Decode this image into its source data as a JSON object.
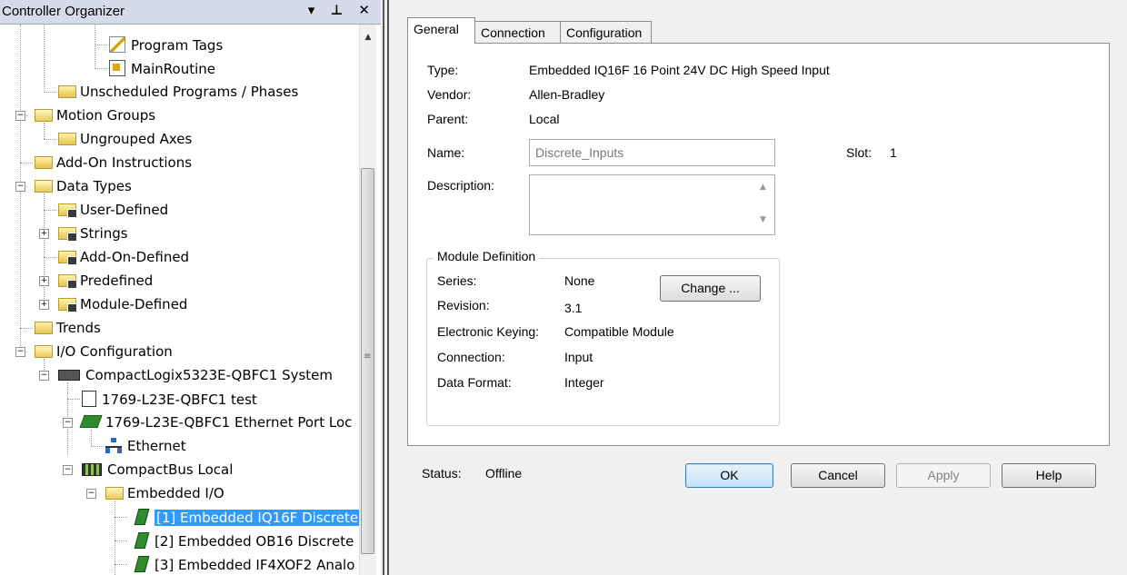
{
  "organizer": {
    "title": "Controller Organizer",
    "header_buttons": "▾ ⊥ ✕",
    "tree": [
      {
        "label": "Program Tags",
        "icon": "pencil-icon"
      },
      {
        "label": "MainRoutine",
        "icon": "routine-icon"
      },
      {
        "label": "Unscheduled Programs / Phases",
        "icon": "folder-icon"
      },
      {
        "label": "Motion Groups",
        "icon": "folder-open-icon"
      },
      {
        "label": "Ungrouped Axes",
        "icon": "folder-icon"
      },
      {
        "label": "Add-On Instructions",
        "icon": "folder-icon"
      },
      {
        "label": "Data Types",
        "icon": "folder-open-icon"
      },
      {
        "label": "User-Defined",
        "icon": "datatype-icon"
      },
      {
        "label": "Strings",
        "icon": "datatype-icon"
      },
      {
        "label": "Add-On-Defined",
        "icon": "datatype-icon"
      },
      {
        "label": "Predefined",
        "icon": "datatype-icon"
      },
      {
        "label": "Module-Defined",
        "icon": "datatype-icon"
      },
      {
        "label": "Trends",
        "icon": "folder-icon"
      },
      {
        "label": "I/O Configuration",
        "icon": "folder-open-icon"
      },
      {
        "label": "CompactLogix5323E-QBFC1 System",
        "icon": "chassis-icon"
      },
      {
        "label": "1769-L23E-QBFC1 test",
        "icon": "controller-icon"
      },
      {
        "label": "1769-L23E-QBFC1 Ethernet Port Loc",
        "icon": "ethernet-module-icon"
      },
      {
        "label": "Ethernet",
        "icon": "network-icon"
      },
      {
        "label": "CompactBus Local",
        "icon": "bus-icon"
      },
      {
        "label": "Embedded I/O",
        "icon": "folder-open-icon"
      },
      {
        "label": "[1] Embedded IQ16F Discrete",
        "icon": "module-icon",
        "selected": true
      },
      {
        "label": "[2] Embedded OB16 Discrete",
        "icon": "module-icon"
      },
      {
        "label": "[3] Embedded IF4XOF2 Analo",
        "icon": "module-icon"
      }
    ]
  },
  "tabs": [
    {
      "label": "General",
      "active": true
    },
    {
      "label": "Connection"
    },
    {
      "label": "Configuration"
    }
  ],
  "general": {
    "type_label": "Type:",
    "type_value": "Embedded IQ16F 16 Point 24V DC High Speed Input",
    "vendor_label": "Vendor:",
    "vendor_value": "Allen-Bradley",
    "parent_label": "Parent:",
    "parent_value": "Local",
    "name_label": "Name:",
    "name_value": "Discrete_Inputs",
    "slot_label": "Slot:",
    "slot_value": "1",
    "description_label": "Description:",
    "description_value": ""
  },
  "module_definition": {
    "title": "Module Definition",
    "rows": [
      {
        "label": "Series:",
        "value": "None"
      },
      {
        "label": "Revision:",
        "value": "3.1"
      },
      {
        "label": "Electronic Keying:",
        "value": "Compatible Module"
      },
      {
        "label": "Connection:",
        "value": "Input"
      },
      {
        "label": "Data Format:",
        "value": "Integer"
      }
    ],
    "change_button": "Change ..."
  },
  "status": {
    "label": "Status:",
    "value": "Offline"
  },
  "buttons": {
    "ok": "OK",
    "cancel": "Cancel",
    "apply": "Apply",
    "help": "Help"
  }
}
